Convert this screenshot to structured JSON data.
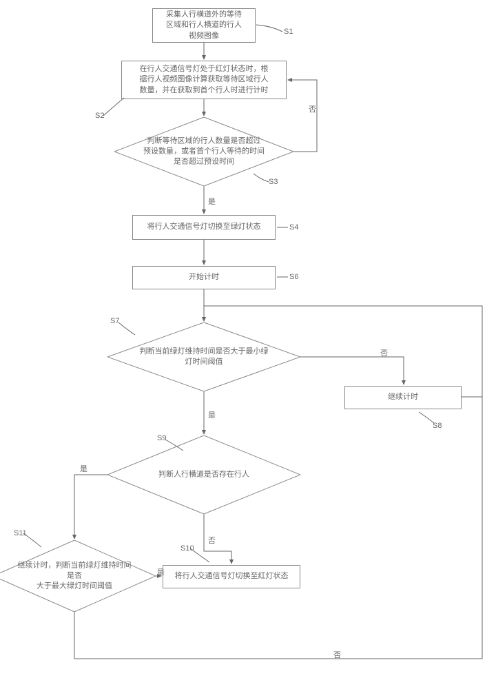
{
  "nodes": {
    "s1": "采集人行横道外的等待\n区域和行人横道的行人\n视频图像",
    "s2": "在行人交通信号灯处于红灯状态时，根\n据行人视频图像计算获取等待区域行人\n数量，并在获取到首个行人时进行计时",
    "s3": "判断等待区域的行人数量是否超过\n预设数量，或者首个行人等待的时间\n是否超过预设时间",
    "s4": "将行人交通信号灯切换至绿灯状态",
    "s6": "开始计时",
    "s7": "判断当前绿灯维持时间是否大于最小绿\n灯时间阈值",
    "s8": "继续计时",
    "s9": "判断人行横道是否存在行人",
    "s10": "将行人交通信号灯切换至红灯状态",
    "s11": "继续计时，判断当前绿灯维持时间是否\n大于最大绿灯时间阈值"
  },
  "labels": {
    "s1": "S1",
    "s2": "S2",
    "s3": "S3",
    "s4": "S4",
    "s6": "S6",
    "s7": "S7",
    "s8": "S8",
    "s9": "S9",
    "s10": "S10",
    "s11": "S11"
  },
  "edges": {
    "yes": "是",
    "no": "否"
  }
}
